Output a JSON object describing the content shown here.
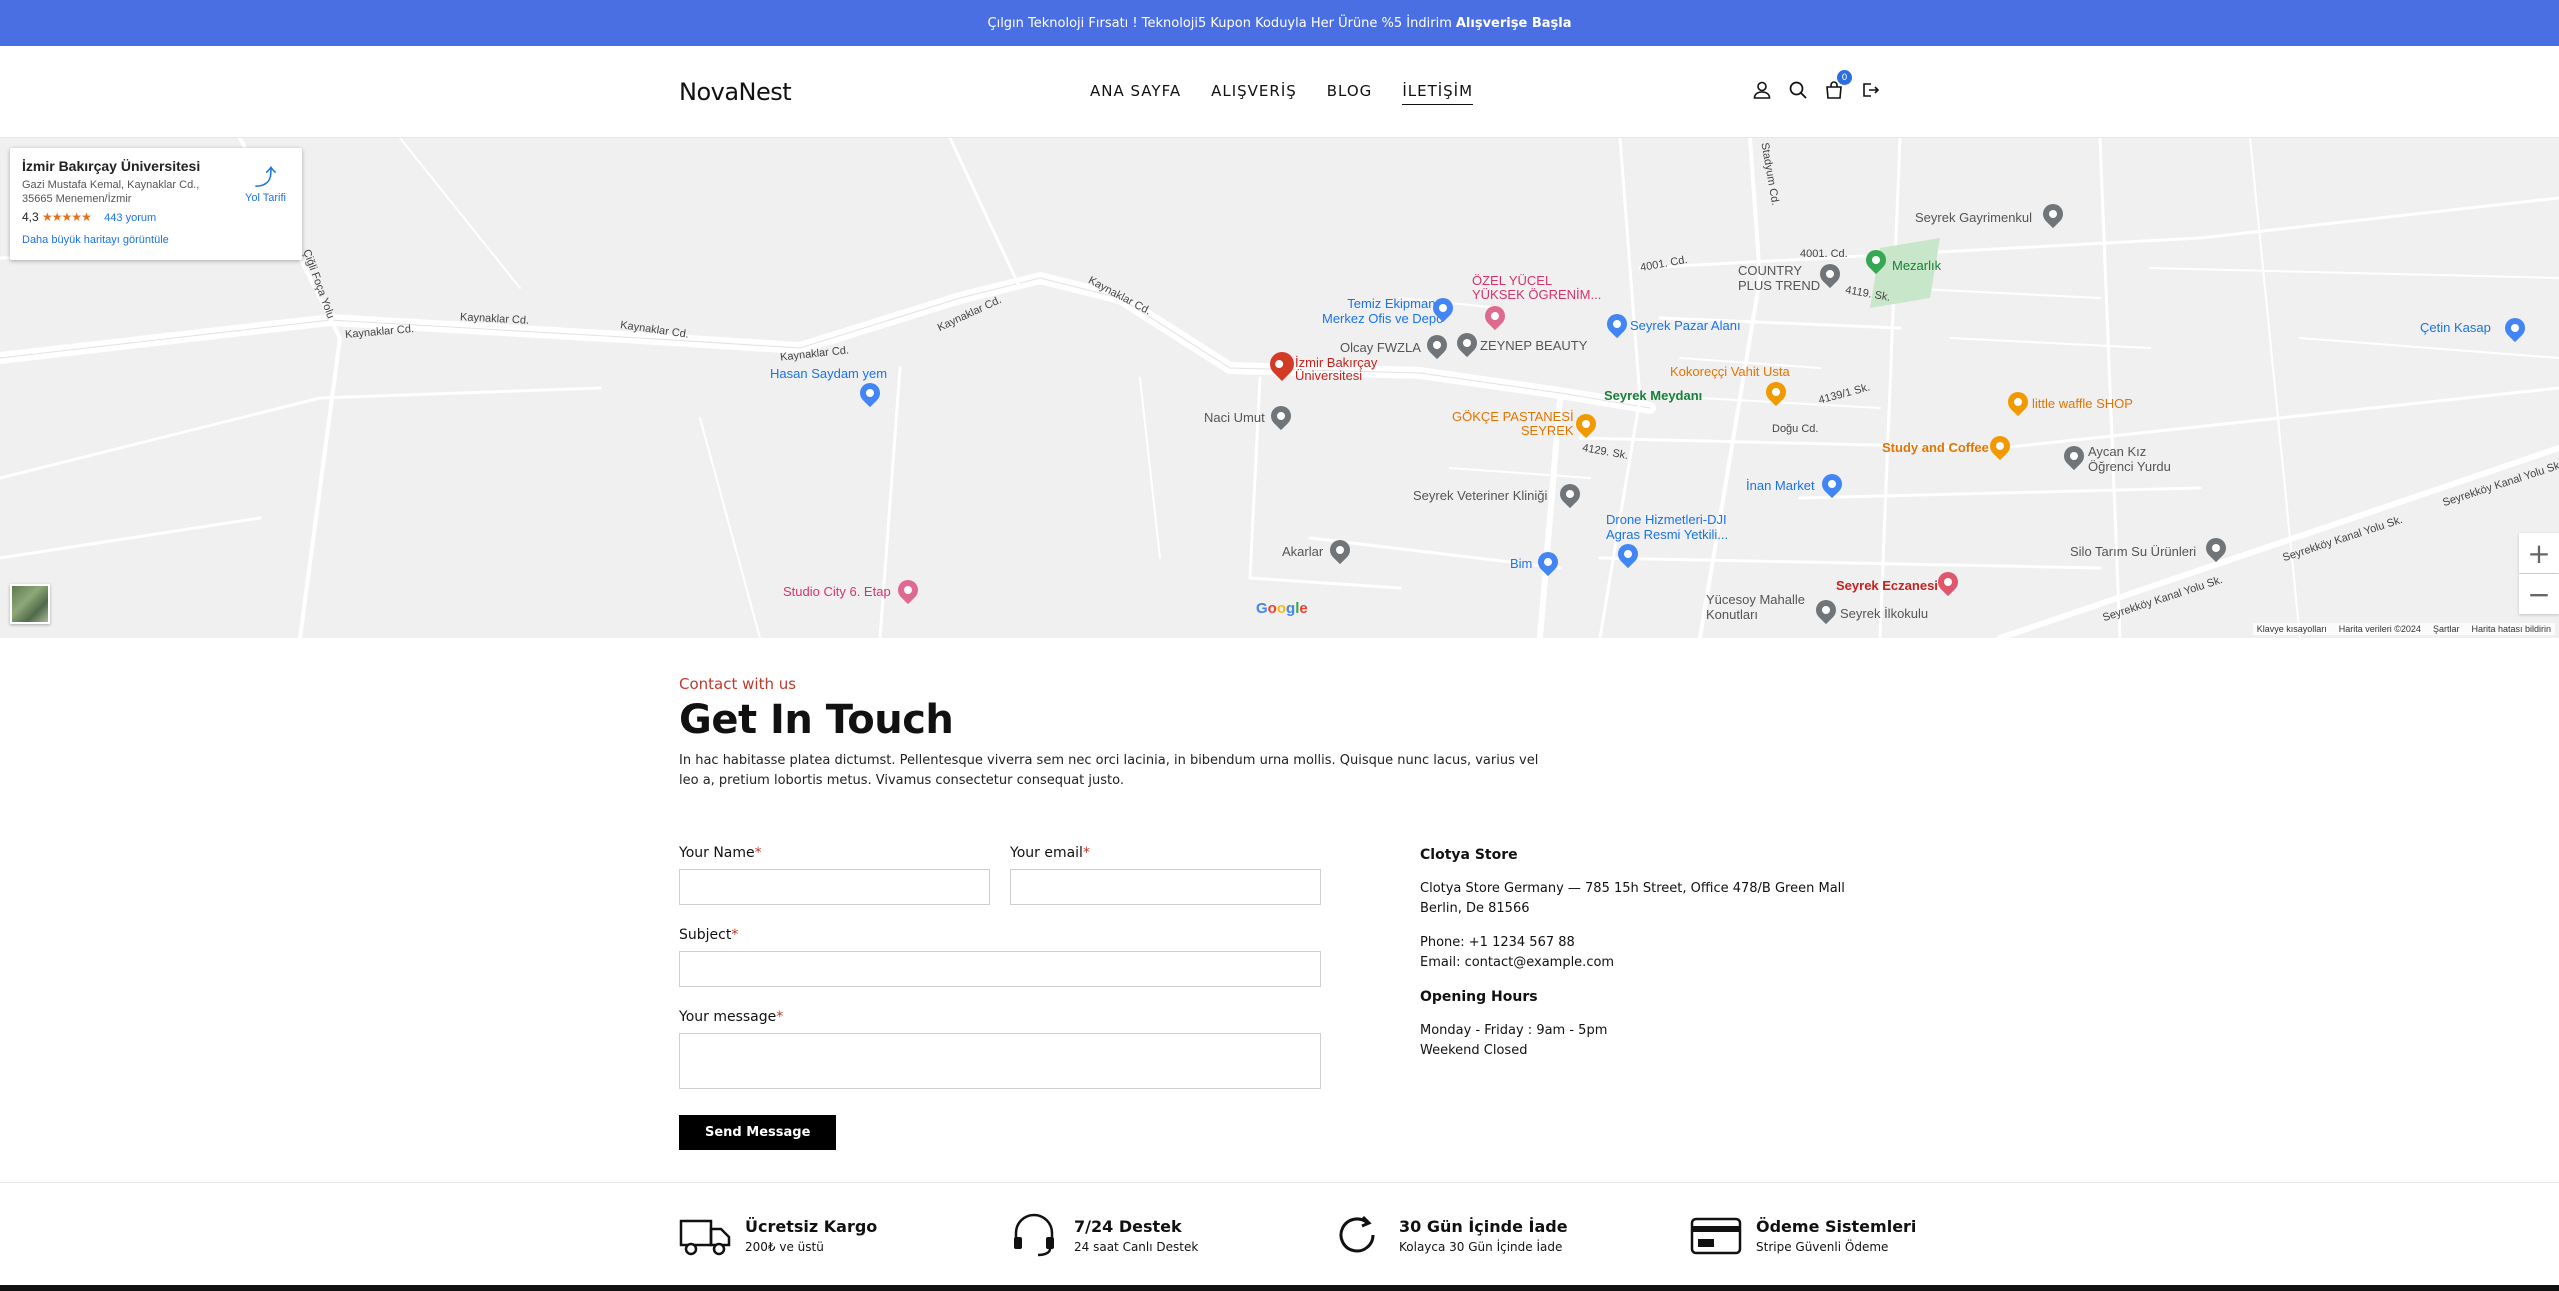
{
  "promo": {
    "text": "Çılgın Teknoloji Fırsatı ! Teknoloji5 Kupon Koduyla Her Ürüne %5 İndirim",
    "cta": "Alışverişe Başla"
  },
  "header": {
    "logo": "NovaNest",
    "nav": [
      "ANA SAYFA",
      "ALIŞVERİŞ",
      "BLOG",
      "İLETİŞİM"
    ],
    "active_nav": "İLETİŞİM",
    "cart_count": "0"
  },
  "map": {
    "place": {
      "title": "İzmir Bakırçay Üniversitesi",
      "address": "Gazi Mustafa Kemal, Kaynaklar Cd., 35665 Menemen/İzmir",
      "rating": "4,3",
      "stars": "★★★★★",
      "reviews": "443 yorum",
      "larger_map": "Daha büyük haritayı görüntüle",
      "directions": "Yol Tarifi"
    },
    "labels": {
      "temiz": "Temiz Ekipman -\nMerkez Ofis ve Depo",
      "ozel": "ÖZEL YÜCEL\nYÜKSEK ÖGRENİM...",
      "olcay": "Olcay FWZLA",
      "zeynep": "ZEYNEP BEAUTY",
      "pazar": "Seyrek Pazar Alanı",
      "country": "COUNTRY\nPLUS TREND",
      "mezarlik": "Mezarlık",
      "gayrimenkul": "Seyrek Gayrimenkul",
      "cetin": "Çetin Kasap",
      "izmir": "İzmir Bakırçay\nÜniversitesi",
      "hasan": "Hasan Saydam yem",
      "naci": "Naci Umut",
      "meydan": "Seyrek Meydanı",
      "kokorecci": "Kokoreççi Vahit Usta",
      "gokce": "GÖKÇE PASTANESİ\nSEYREK",
      "waffle": "little waffle SHOP",
      "study": "Study and Coffee",
      "aycan": "Aycan Kız\nÖğrenci Yurdu",
      "inan": "İnan Market",
      "veteriner": "Seyrek Veteriner Kliniği",
      "drone": "Drone Hizmetleri-DJI\nAgras Resmi Yetkili...",
      "akarlar": "Akarlar",
      "bim": "Bim",
      "studio": "Studio City 6. Etap",
      "eczane": "Seyrek Eczanesi",
      "yucesoy": "Yücesoy Mahalle\nKonutları",
      "ilkokulu": "Seyrek İlkokulu",
      "silo": "Silo Tarım Su Ürünleri"
    },
    "roads": {
      "k1": "Kaynaklar Cd.",
      "k2": "Kaynaklar Cd.",
      "k3": "Kaynaklar Cd.",
      "k4": "Kaynaklar Cd.",
      "k5": "Kaynaklar Cd.",
      "k6": "Kaynaklar Cd.",
      "cigli": "Çiğli Foça Yolu",
      "stadyum": "Stadyum Cd.",
      "c4001a": "4001. Cd.",
      "c4001b": "4001. Cd.",
      "s4119": "4119. Sk.",
      "s4139": "4139/1 Sk.",
      "dogu": "Doğu Cd.",
      "s4129": "4129. Sk.",
      "kanal1": "Seyrekköy Kanal Yolu Sk.",
      "kanal2": "Seyrekköy Kanal Yolu Sk.",
      "kanal3": "Seyrekköy Kanal Yolu Sk."
    },
    "google": "Google",
    "footer": [
      "Klavye kısayolları",
      "Harita verileri ©2024",
      "Şartlar",
      "Harita hatası bildirin"
    ]
  },
  "contact": {
    "eyebrow": "Contact with us",
    "title": "Get In Touch",
    "intro": "In hac habitasse platea dictumst. Pellentesque viverra sem nec orci lacinia, in bibendum urna mollis. Quisque nunc lacus, varius vel leo a, pretium lobortis metus. Vivamus consectetur consequat justo.",
    "form": {
      "name_label": "Your Name",
      "email_label": "Your email",
      "subject_label": "Subject",
      "message_label": "Your message",
      "required_mark": "*",
      "submit": "Send Message"
    },
    "store": {
      "title": "Clotya Store",
      "address": "Clotya Store Germany — 785 15h Street, Office 478/B Green Mall Berlin, De 81566",
      "phone": "Phone: +1 1234 567 88",
      "email": "Email: contact@example.com",
      "hours_title": "Opening Hours",
      "hours_1": "Monday - Friday : 9am - 5pm",
      "hours_2": "Weekend Closed"
    }
  },
  "features": [
    {
      "title": "Ücretsiz Kargo",
      "sub": "200₺ ve üstü",
      "icon": "truck-icon"
    },
    {
      "title": "7/24 Destek",
      "sub": "24 saat Canlı Destek",
      "icon": "headset-icon"
    },
    {
      "title": "30 Gün İçinde İade",
      "sub": "Kolayca 30 Gün İçinde İade",
      "icon": "refresh-icon"
    },
    {
      "title": "Ödeme Sistemleri",
      "sub": "Stripe Güvenli Ödeme",
      "icon": "credit-card-icon"
    }
  ],
  "colors": {
    "promo_bg": "#4a6fe3",
    "accent_red": "#c0392b",
    "cart_badge": "#2c6de0",
    "map_link": "#1a73e8"
  }
}
